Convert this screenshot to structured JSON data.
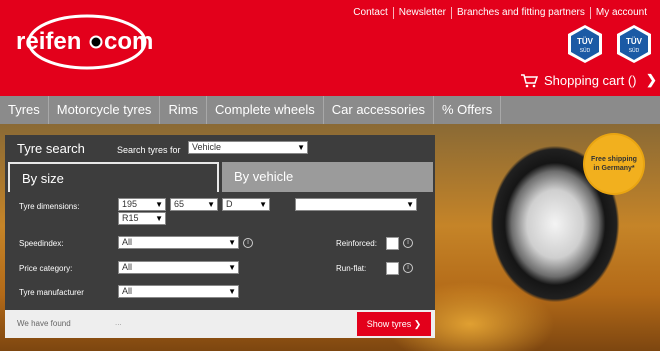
{
  "header": {
    "logo_text": "reifen.com",
    "top_links": [
      "Contact",
      "Newsletter",
      "Branches and fitting partners",
      "My account"
    ],
    "tuv_badges": [
      "TÜV SÜD",
      "TÜV SÜD"
    ],
    "cart_label": "Shopping cart ()",
    "cart_arrow": "❯"
  },
  "nav": {
    "items": [
      "Tyres",
      "Motorcycle tyres",
      "Rims",
      "Complete wheels",
      "Car accessories",
      "% Offers"
    ]
  },
  "promo": {
    "badge_text": "Free shipping in Germany*"
  },
  "search": {
    "title": "Tyre search",
    "search_for_label": "Search tyres for",
    "search_for_value": "Vehicle",
    "tabs": [
      "By size",
      "By vehicle"
    ],
    "dimensions_label": "Tyre dimensions:",
    "width_value": "195",
    "ratio_value": "65",
    "construction_value": "D",
    "extra_value": "",
    "rim_value": "R15",
    "speedindex_label": "Speedindex:",
    "speedindex_value": "All",
    "price_label": "Price category:",
    "price_value": "All",
    "manufacturer_label": "Tyre manufacturer",
    "manufacturer_value": "All",
    "reinforced_label": "Reinforced:",
    "runflat_label": "Run-flat:",
    "found_label": "We have found",
    "found_value": "...",
    "show_button": "Show tyres ❯"
  },
  "colors": {
    "brand_red": "#e3001b",
    "nav_grey": "#8b8b8b",
    "panel_dark": "#3d3d3d"
  }
}
